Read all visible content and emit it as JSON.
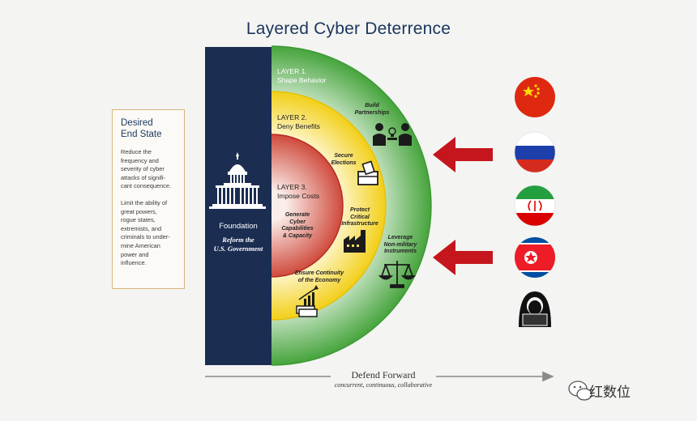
{
  "title": "Layered Cyber Deterrence",
  "desired_end_state": {
    "title_line1": "Desired",
    "title_line2": "End State",
    "para1": [
      "Reduce the",
      "frequency and",
      "severity of cyber",
      "attacks of signifi-",
      "cant consequence."
    ],
    "para2": [
      "Limit the ability of",
      "great powers,",
      "rogue states,",
      "extremists, and",
      "criminals to under-",
      "mine American",
      "power and",
      "influence."
    ]
  },
  "foundation": {
    "label": "Foundation",
    "sub_line1": "Reform the",
    "sub_line2": "U.S. Government"
  },
  "layers": {
    "layer1": {
      "line1": "LAYER 1.",
      "line2": "Shape Behavior"
    },
    "layer2": {
      "line1": "LAYER 2.",
      "line2": "Deny Benefits"
    },
    "layer3": {
      "line1": "LAYER 3.",
      "line2": "Impose Costs"
    }
  },
  "elements": {
    "build_partnerships": [
      "Build",
      "Partnerships"
    ],
    "secure_elections": [
      "Secure",
      "Elections"
    ],
    "protect_infrastructure": [
      "Protect",
      "Critical",
      "Infrastructure"
    ],
    "generate_capabilities": [
      "Generate",
      "Cyber",
      "Capabilities",
      "& Capacity"
    ],
    "leverage_instruments": [
      "Leverage",
      "Non-military",
      "Instruments"
    ],
    "ensure_continuity": [
      "Ensure Continuity",
      "of the Economy"
    ]
  },
  "defend_forward": {
    "label": "Defend Forward",
    "sub": "concurrent, continuous, collaborative"
  },
  "threats": [
    "china-flag",
    "russia-flag",
    "iran-flag",
    "north-korea-flag",
    "hacker"
  ],
  "watermark": "红数位",
  "colors": {
    "navy": "#1b2e52",
    "green": "#4aa541",
    "yellow": "#f2d21c",
    "red": "#c8352f",
    "arrow_red": "#c4161c",
    "title": "#1a365d"
  }
}
